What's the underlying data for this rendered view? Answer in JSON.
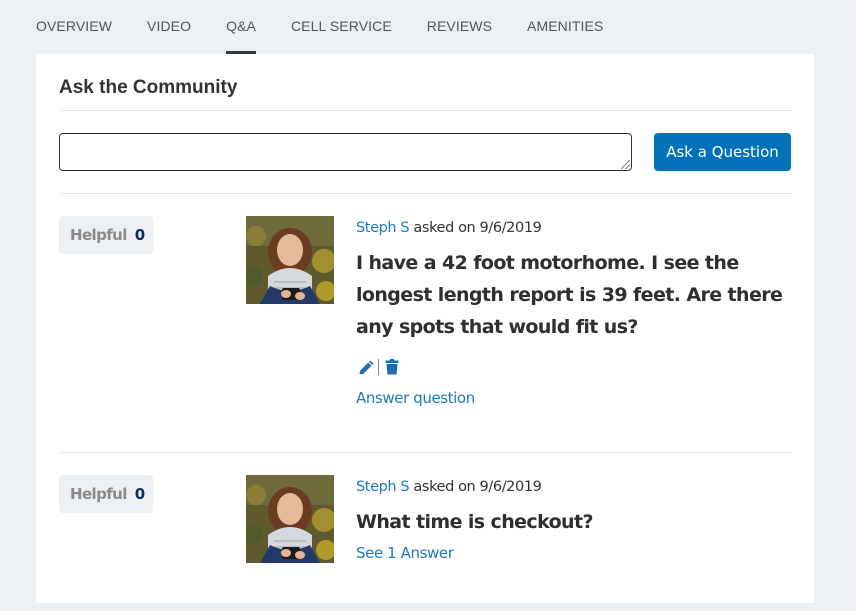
{
  "tabs": [
    {
      "label": "OVERVIEW",
      "active": false
    },
    {
      "label": "VIDEO",
      "active": false
    },
    {
      "label": "Q&A",
      "active": true
    },
    {
      "label": "CELL SERVICE",
      "active": false
    },
    {
      "label": "REVIEWS",
      "active": false
    },
    {
      "label": "AMENITIES",
      "active": false
    }
  ],
  "community": {
    "title": "Ask the Community",
    "input_value": "",
    "input_placeholder": "",
    "ask_button_label": "Ask a Question"
  },
  "colors": {
    "accent": "#0272b8",
    "link": "#1a7bbf",
    "background": "#edf0f3"
  },
  "questions": [
    {
      "helpful_label": "Helpful",
      "helpful_count": "0",
      "author": "Steph S",
      "asked_text": " asked on 9/6/2019",
      "question": "I have a 42 foot motorhome. I see the longest length report is 39 feet. Are there any spots that would fit us?",
      "edit_icon": "pencil-icon",
      "delete_icon": "trash-icon",
      "action_link": "Answer question"
    },
    {
      "helpful_label": "Helpful",
      "helpful_count": "0",
      "author": "Steph S",
      "asked_text": " asked on 9/6/2019",
      "question": "What time is checkout?",
      "action_link": "See 1 Answer"
    }
  ]
}
